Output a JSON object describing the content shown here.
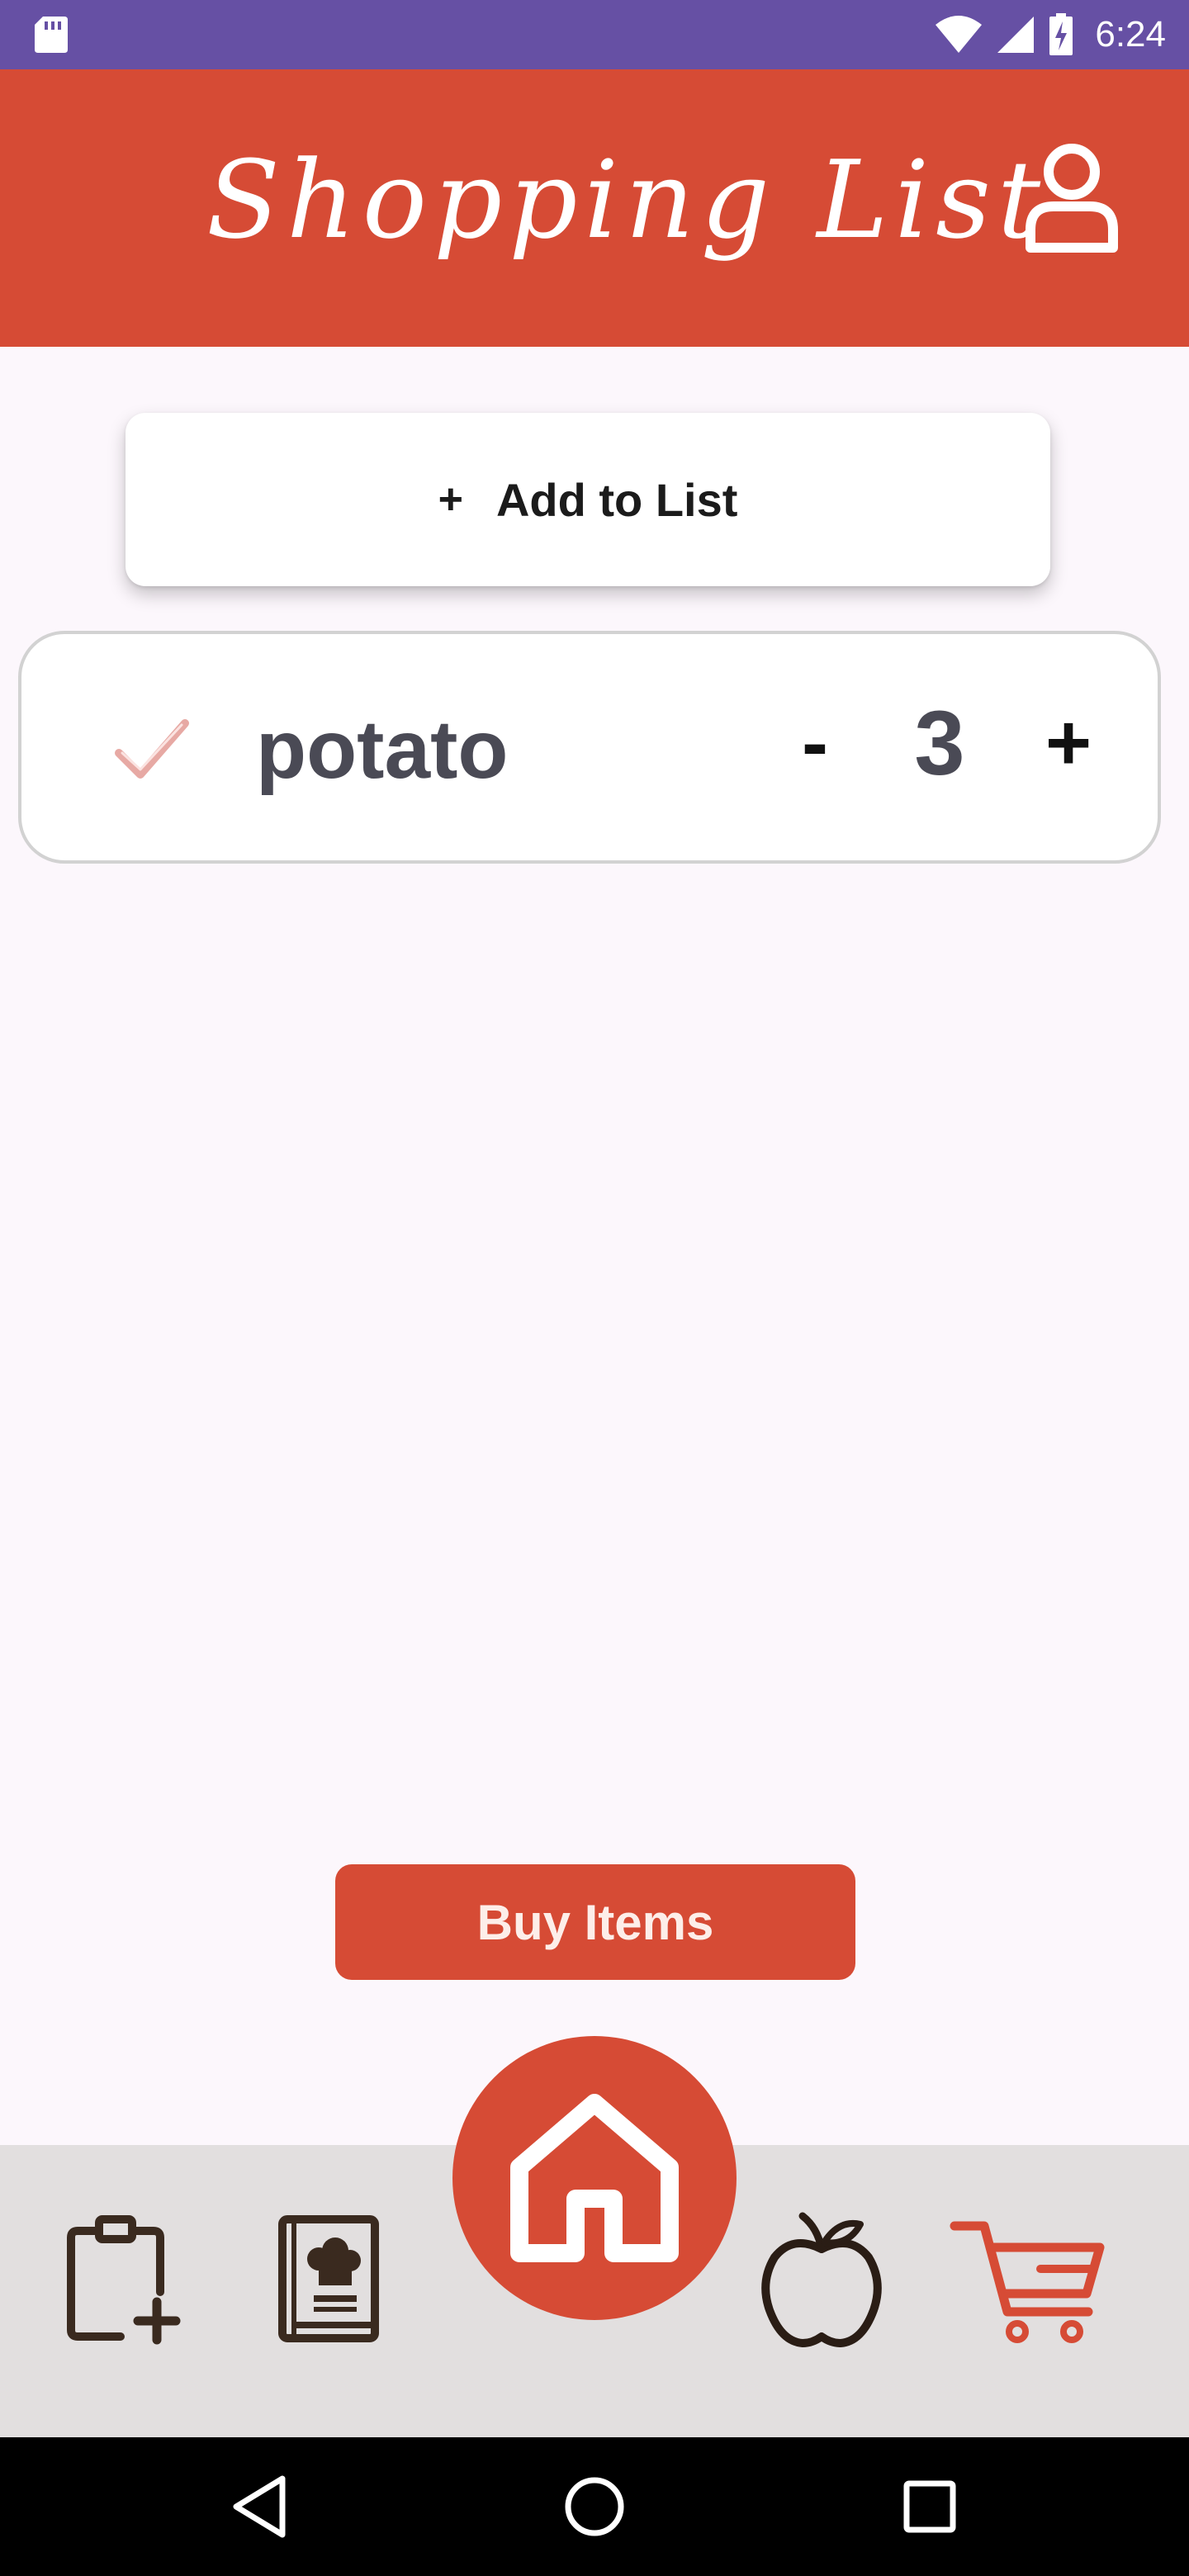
{
  "status_bar": {
    "time": "6:24",
    "icons": [
      "sd-card-icon",
      "wifi-icon",
      "signal-icon",
      "battery-charging-icon"
    ]
  },
  "app_bar": {
    "title": "Shopping List",
    "profile_icon": "user-icon"
  },
  "add_button": {
    "plus": "+",
    "label": "Add to List"
  },
  "list": {
    "items": [
      {
        "name": "potato",
        "quantity": "3",
        "checked": true,
        "decrement_label": "-",
        "increment_label": "+"
      }
    ]
  },
  "buy_button": {
    "label": "Buy Items"
  },
  "bottom_nav": {
    "items": [
      {
        "icon": "clipboard-add-icon",
        "active": false
      },
      {
        "icon": "recipe-book-icon",
        "active": false
      },
      {
        "icon": "home-icon",
        "active": false
      },
      {
        "icon": "apple-icon",
        "active": false
      },
      {
        "icon": "cart-icon",
        "active": true
      }
    ]
  },
  "colors": {
    "status_bar": "#6650a4",
    "primary": "#d64b35",
    "background": "#fcf7fc",
    "nav_background": "#e2dfdf",
    "icon_dark": "#3a2a1f"
  },
  "system_nav": {
    "buttons": [
      "back-icon",
      "home-circle-icon",
      "recents-icon"
    ]
  }
}
